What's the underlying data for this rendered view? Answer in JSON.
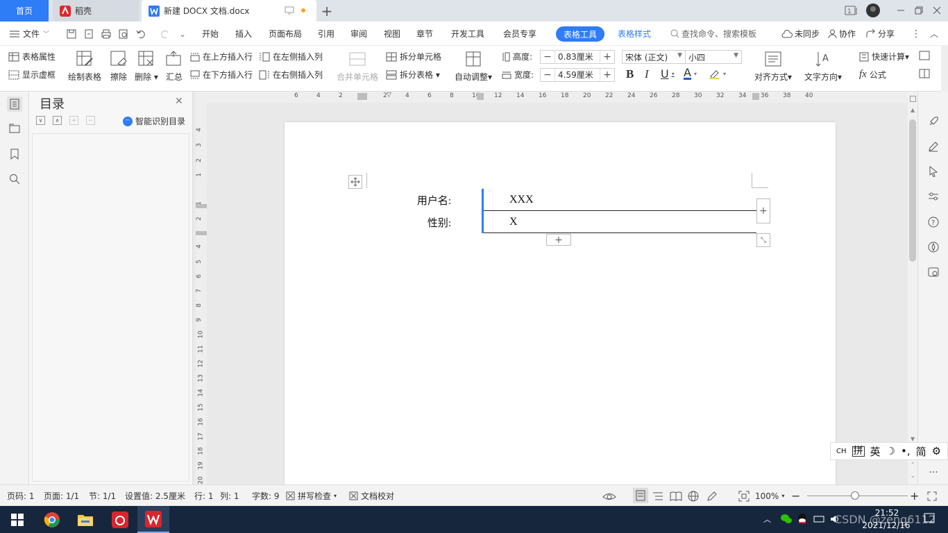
{
  "tabs": {
    "home": "首页",
    "daoke": "稻壳",
    "doc": "新建 DOCX 文档.docx"
  },
  "menu": {
    "file": "文件",
    "items": [
      "开始",
      "插入",
      "页面布局",
      "引用",
      "审阅",
      "视图",
      "章节",
      "开发工具",
      "会员专享"
    ],
    "table_tools": "表格工具",
    "table_style": "表格样式",
    "search_placeholder": "查找命令、搜索模板",
    "unsynced": "未同步",
    "collab": "协作",
    "share": "分享"
  },
  "ribbon": {
    "table_props": "表格属性",
    "show_grid": "显示虚框",
    "draw_table": "绘制表格",
    "erase": "擦除",
    "delete": "删除",
    "summary": "汇总",
    "insert_row_above": "在上方插入行",
    "insert_row_below": "在下方插入行",
    "insert_col_left": "在左侧插入列",
    "insert_col_right": "在右侧插入列",
    "merge_cells": "合并单元格",
    "split_cells": "拆分单元格",
    "split_table": "拆分表格",
    "auto_fit": "自动调整",
    "height_label": "高度:",
    "height_value": "0.83厘米",
    "width_label": "宽度:",
    "width_value": "4.59厘米",
    "font_name": "宋体 (正文)",
    "font_size": "小四",
    "align": "对齐方式",
    "text_dir": "文字方向",
    "quick_calc": "快速计算",
    "formula": "公式"
  },
  "outline": {
    "title": "目录",
    "smart": "智能识别目录"
  },
  "hruler_ticks": [
    "6",
    "4",
    "2",
    "2",
    "4",
    "6",
    "8",
    "10",
    "12",
    "14",
    "16",
    "18",
    "20",
    "22",
    "24",
    "26",
    "28",
    "30",
    "32",
    "34",
    "36",
    "38",
    "40"
  ],
  "vruler_ticks": [
    "4",
    "3",
    "2",
    "1",
    "1",
    "2",
    "3",
    "4",
    "5",
    "6",
    "7",
    "8",
    "9",
    "10",
    "11",
    "12",
    "13",
    "14",
    "15",
    "16",
    "17",
    "18",
    "19",
    "20"
  ],
  "table": {
    "rows": [
      {
        "label": "用户名:",
        "value": "XXX"
      },
      {
        "label": "性别:",
        "value": "X"
      }
    ]
  },
  "ime": {
    "ch": "CH",
    "pin": "拼",
    "en": "英",
    "jian": "简"
  },
  "status": {
    "page_code": "页码: 1",
    "page": "页面: 1/1",
    "section": "节: 1/1",
    "setting": "设置值: 2.5厘米",
    "row": "行: 1",
    "col": "列: 1",
    "words": "字数: 9",
    "spell": "拼写检查",
    "proof": "文档校对",
    "zoom": "100%"
  },
  "taskbar": {
    "time": "21:52",
    "date": "2021/12/16",
    "watermark": "CSDN @zeng6112"
  },
  "colors": {
    "accent": "#2e7cf6",
    "taskbar": "#16273d",
    "wps_red": "#d9252c"
  }
}
